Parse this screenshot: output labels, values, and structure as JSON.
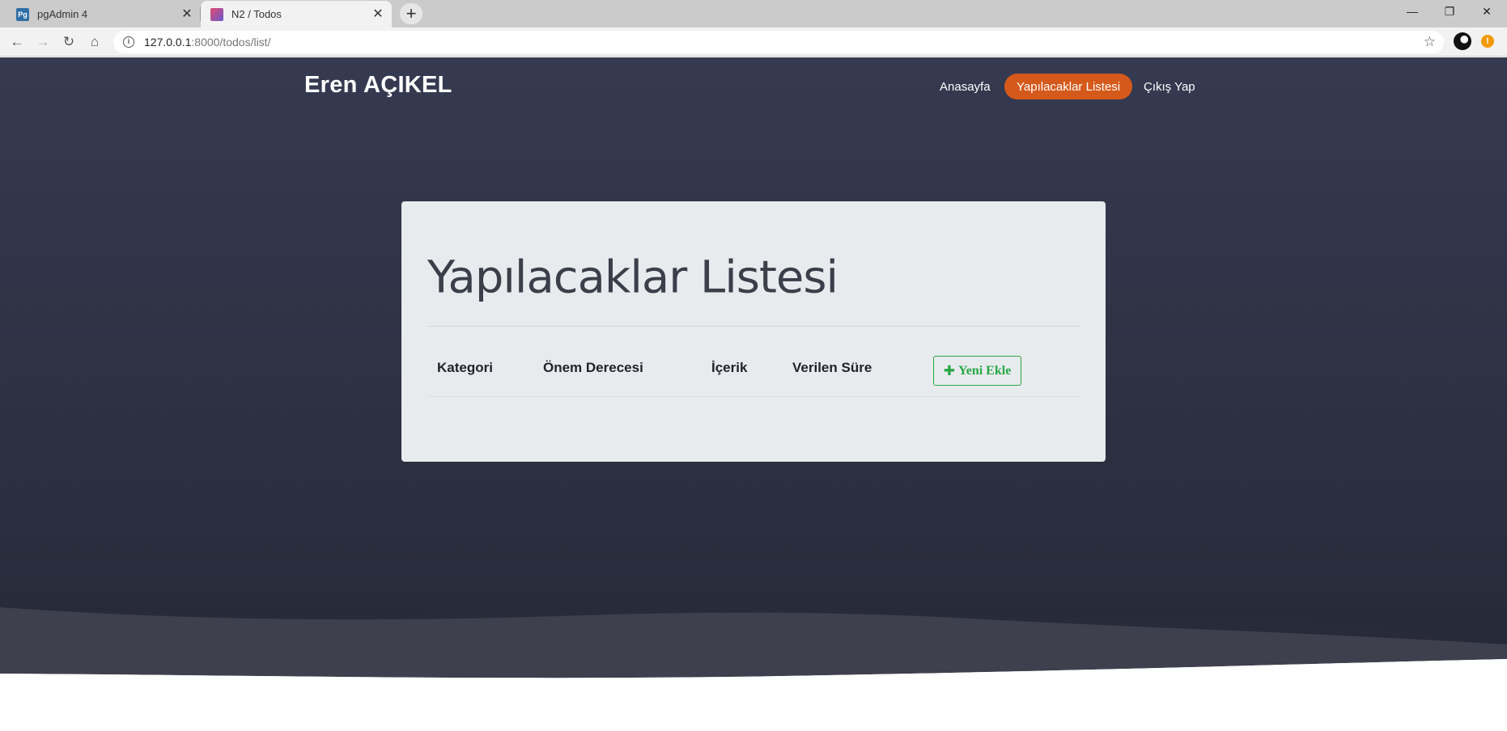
{
  "browser": {
    "tabs": [
      {
        "favicon": "Pg",
        "title": "pgAdmin 4",
        "active": false
      },
      {
        "favicon": "N2",
        "title": "N2 / Todos",
        "active": true
      }
    ],
    "new_tab_icon": "plus-icon",
    "url_host": "127.0.0.1",
    "url_path": ":8000/todos/list/",
    "window_controls": [
      "minimize-icon",
      "restore-icon",
      "close-icon"
    ]
  },
  "site": {
    "brand": "Eren AÇIKEL",
    "nav": [
      {
        "label": "Anasayfa",
        "active": false
      },
      {
        "label": "Yapılacaklar Listesi",
        "active": true
      },
      {
        "label": "Çıkış Yap",
        "active": false
      }
    ]
  },
  "card": {
    "title": "Yapılacaklar Listesi",
    "columns": [
      "Kategori",
      "Önem Derecesi",
      "İçerik",
      "Verilen Süre"
    ],
    "add_button": "Yeni Ekle"
  },
  "colors": {
    "hero_top": "#363a51",
    "hero_bottom": "#272a38",
    "accent": "#d4591a",
    "success": "#28a745",
    "card_bg": "#e8ebee"
  }
}
